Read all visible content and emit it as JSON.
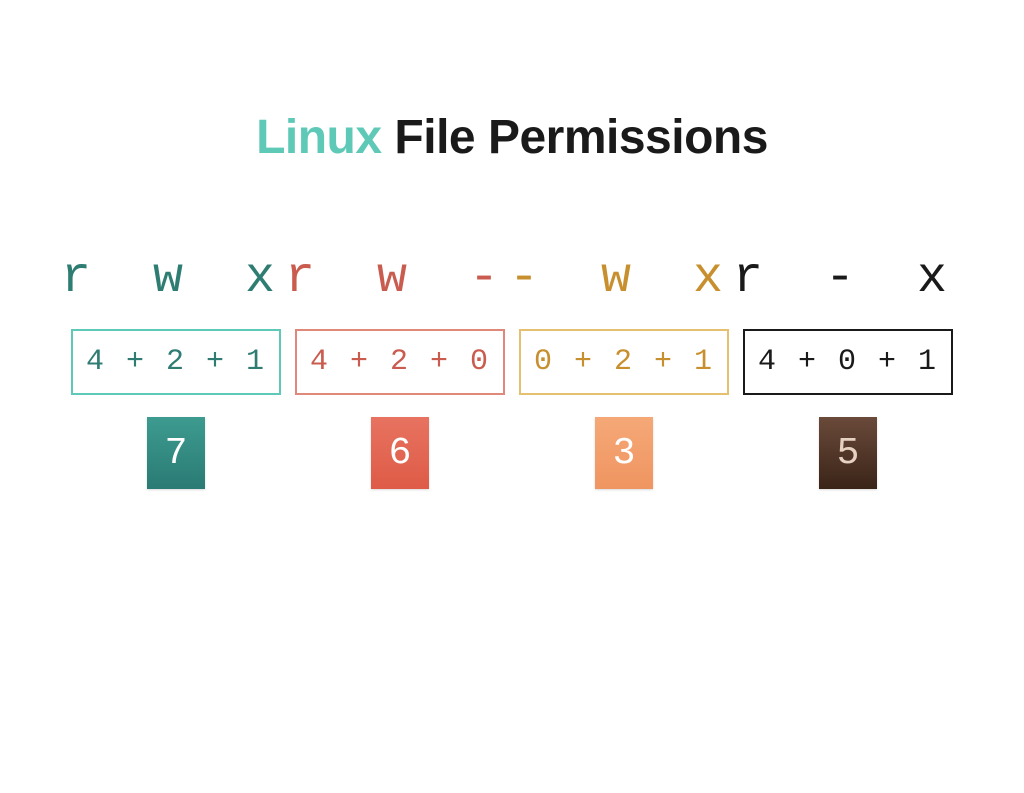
{
  "title": {
    "accent": "Linux",
    "main": "File Permissions"
  },
  "groups": [
    {
      "symbols": "r w x",
      "calc": "4 + 2 + 1",
      "result": "7"
    },
    {
      "symbols": "r w -",
      "calc": "4 + 2 + 0",
      "result": "6"
    },
    {
      "symbols": "- w x",
      "calc": "0 + 2 + 1",
      "result": "3"
    },
    {
      "symbols": "r - x",
      "calc": "4 + 0 + 1",
      "result": "5"
    }
  ]
}
